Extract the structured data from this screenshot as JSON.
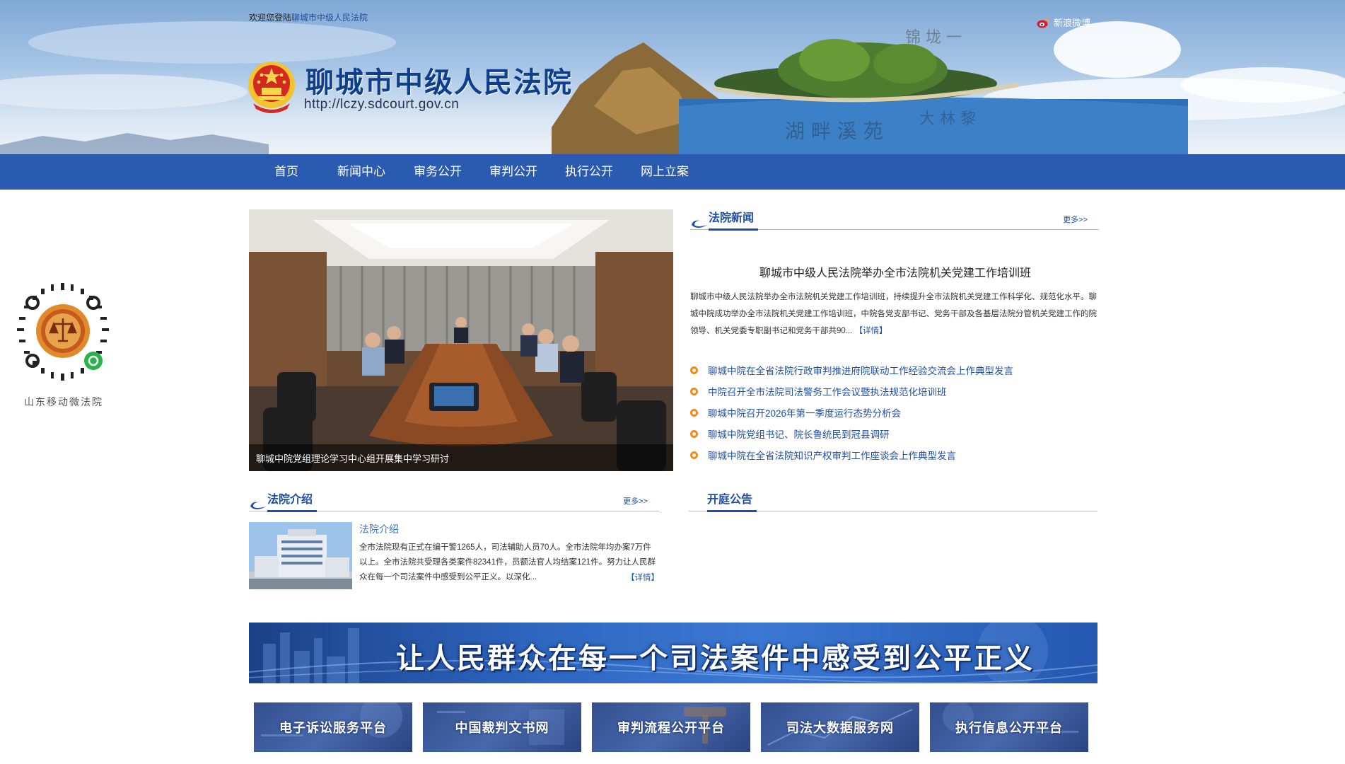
{
  "header": {
    "welcome_prefix": "欢迎您登陆",
    "welcome_site": "聊城市中级人民法院",
    "court_name": "聊城市中级人民法院",
    "court_url": "http://lczy.sdcourt.gov.cn",
    "weibo_label": "新浪微博"
  },
  "nav": {
    "items": [
      {
        "label": "首页"
      },
      {
        "label": "新闻中心"
      },
      {
        "label": "审务公开"
      },
      {
        "label": "审判公开"
      },
      {
        "label": "执行公开"
      },
      {
        "label": "网上立案"
      }
    ]
  },
  "qr": {
    "label": "山东移动微法院"
  },
  "slideshow": {
    "caption": "聊城中院党组理论学习中心组开展集中学习研讨"
  },
  "court_news": {
    "title": "法院新闻",
    "more": "更多>>",
    "headline": "聊城市中级人民法院举办全市法院机关党建工作培训班",
    "summary": "聊城市中级人民法院举办全市法院机关党建工作培训班，持续提升全市法院机关党建工作科学化、规范化水平。聊城中院成功举办全市法院机关党建工作培训班，中院各党支部书记、党务干部及各基层法院分管机关党建工作的院领导、机关党委专职副书记和党务干部共90...",
    "detail_link": "【详情】",
    "items": [
      {
        "text": "聊城中院在全省法院行政审判推进府院联动工作经验交流会上作典型发言"
      },
      {
        "text": "中院召开全市法院司法警务工作会议暨执法规范化培训班"
      },
      {
        "text": "聊城中院召开2026年第一季度运行态势分析会"
      },
      {
        "text": "聊城中院党组书记、院长鲁统民到冠县调研"
      },
      {
        "text": "聊城中院在全省法院知识产权审判工作座谈会上作典型发言"
      }
    ]
  },
  "court_intro": {
    "title": "法院介绍",
    "more": "更多>>",
    "item_title": "法院介绍",
    "text": "全市法院现有正式在编干警1265人，司法辅助人员70人。全市法院年均办案7万件以上。全市法院共受理各类案件82341件，员额法官人均结案121件。努力让人民群众在每一个司法案件中感受到公平正义。以深化...",
    "detail_link": "【详情】"
  },
  "announcements": {
    "title": "开庭公告"
  },
  "banner": {
    "slogan": "让人民群众在每一个司法案件中感受到公平正义"
  },
  "platforms": [
    {
      "label": "电子诉讼服务平台"
    },
    {
      "label": "中国裁判文书网"
    },
    {
      "label": "审判流程公开平台"
    },
    {
      "label": "司法大数据服务网"
    },
    {
      "label": "执行信息公开平台"
    }
  ],
  "colors": {
    "nav_bg": "#2a5bb1",
    "accent": "#1f4fa3",
    "bullet": "#f08a1c"
  }
}
